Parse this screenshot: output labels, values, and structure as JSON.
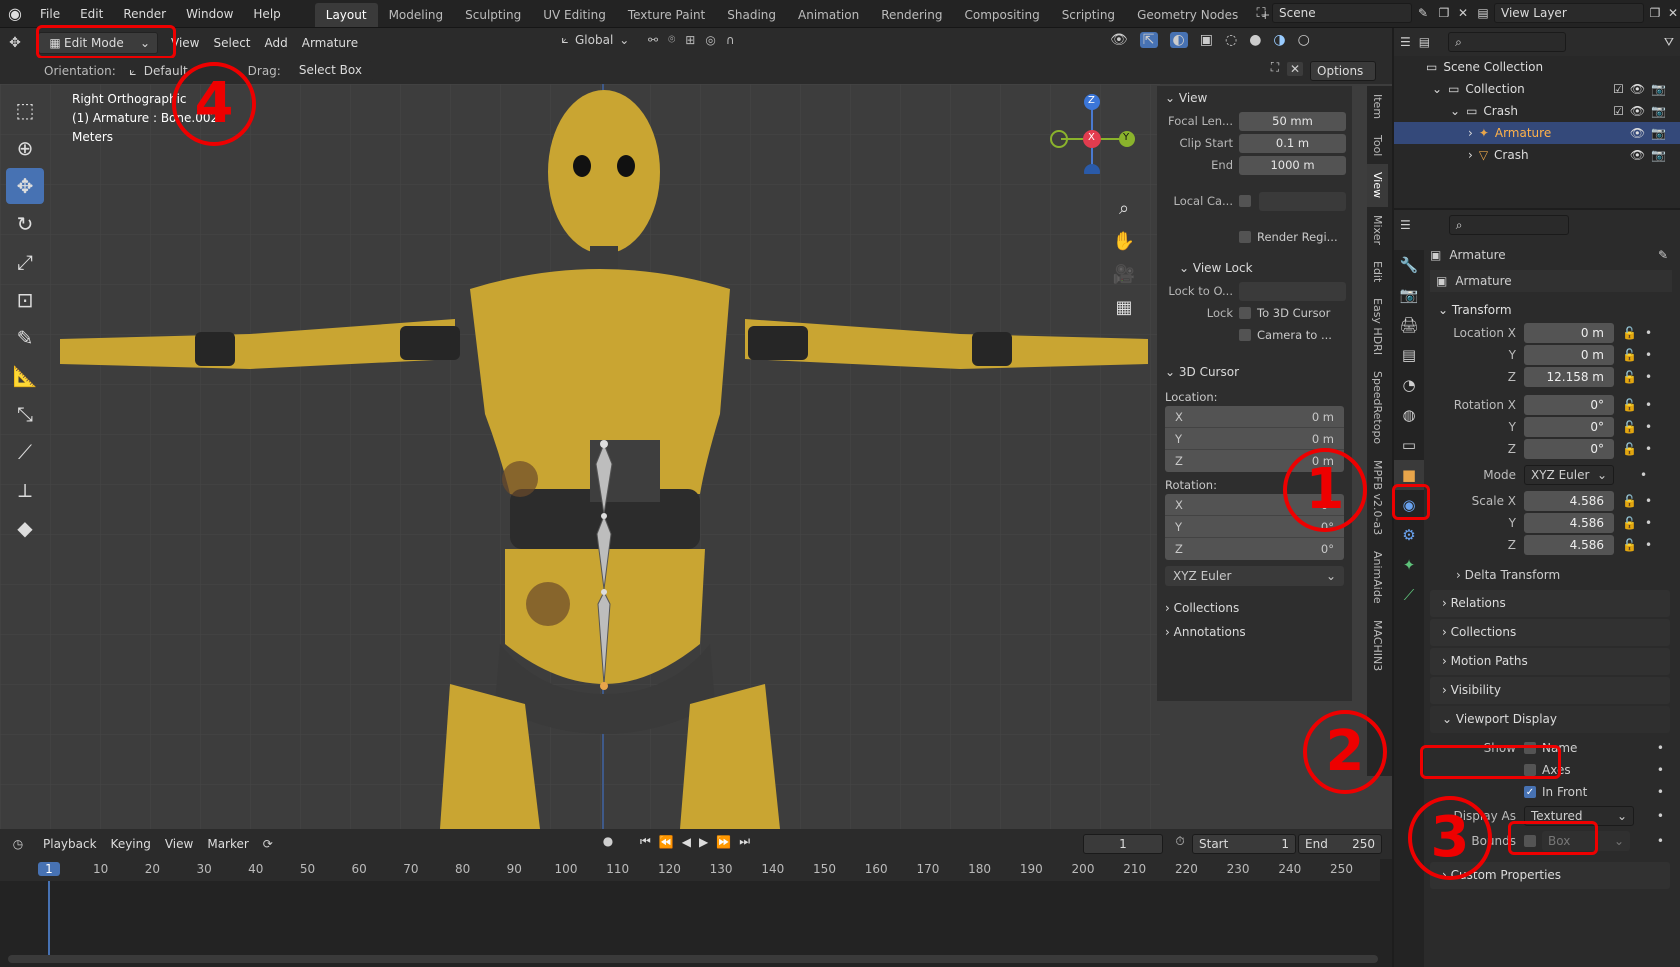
{
  "topbar": {
    "menus": [
      "File",
      "Edit",
      "Render",
      "Window",
      "Help"
    ],
    "workspaces": [
      "Layout",
      "Modeling",
      "Sculpting",
      "UV Editing",
      "Texture Paint",
      "Shading",
      "Animation",
      "Rendering",
      "Compositing",
      "Scripting",
      "Geometry Nodes"
    ],
    "active_workspace": "Layout",
    "add_tab": "+",
    "scene": "Scene",
    "view_layer": "View Layer"
  },
  "viewport_header": {
    "mode": "Edit Mode",
    "menus": [
      "View",
      "Select",
      "Add",
      "Armature"
    ],
    "transform_orientation": "Global",
    "orientation_label": "Orientation:",
    "orientation_value": "Default",
    "drag_label": "Drag:",
    "drag_value": "Select Box",
    "options": "Options"
  },
  "viewport": {
    "view_name": "Right Orthographic",
    "object_info": "(1) Armature : Bone.002",
    "units": "Meters",
    "gizmo": {
      "x": "X",
      "y": "Y",
      "z": "Z"
    }
  },
  "npanel": {
    "view": {
      "title": "View",
      "focal_label": "Focal Len...",
      "focal_value": "50 mm",
      "clip_start_label": "Clip Start",
      "clip_start_value": "0.1 m",
      "end_label": "End",
      "end_value": "1000 m",
      "local_camera_label": "Local Ca...",
      "render_region": "Render Regi..."
    },
    "view_lock": {
      "title": "View Lock",
      "lock_to_label": "Lock to O...",
      "lock_label": "Lock",
      "to_cursor": "To 3D Cursor",
      "camera_to": "Camera to ..."
    },
    "cursor": {
      "title": "3D Cursor",
      "location_label": "Location:",
      "loc": [
        {
          "axis": "X",
          "value": "0 m"
        },
        {
          "axis": "Y",
          "value": "0 m"
        },
        {
          "axis": "Z",
          "value": "0 m"
        }
      ],
      "rotation_label": "Rotation:",
      "rot": [
        {
          "axis": "X",
          "value": "0°"
        },
        {
          "axis": "Y",
          "value": "0°"
        },
        {
          "axis": "Z",
          "value": "0°"
        }
      ],
      "mode": "XYZ Euler"
    },
    "collections": "Collections",
    "annotations": "Annotations",
    "tabs": [
      "Item",
      "Tool",
      "View",
      "Mixer",
      "Edit",
      "Easy HDRI",
      "SpeedRetopo",
      "MPFB v2.0-a3",
      "AnimAide",
      "MACHIN3"
    ]
  },
  "outliner": {
    "root": "Scene Collection",
    "items": [
      {
        "label": "Collection",
        "indent": 1
      },
      {
        "label": "Crash",
        "indent": 2
      },
      {
        "label": "Armature",
        "indent": 3,
        "selected": true
      },
      {
        "label": "Crash",
        "indent": 3
      }
    ]
  },
  "properties": {
    "object_name": "Armature",
    "data_name": "Armature",
    "transform_title": "Transform",
    "location": [
      {
        "label": "Location X",
        "value": "0 m"
      },
      {
        "label": "Y",
        "value": "0 m"
      },
      {
        "label": "Z",
        "value": "12.158 m"
      }
    ],
    "rotation": [
      {
        "label": "Rotation X",
        "value": "0°"
      },
      {
        "label": "Y",
        "value": "0°"
      },
      {
        "label": "Z",
        "value": "0°"
      }
    ],
    "mode_label": "Mode",
    "mode_value": "XYZ Euler",
    "scale": [
      {
        "label": "Scale X",
        "value": "4.586"
      },
      {
        "label": "Y",
        "value": "4.586"
      },
      {
        "label": "Z",
        "value": "4.586"
      }
    ],
    "delta_transform": "Delta Transform",
    "sections": [
      "Relations",
      "Collections",
      "Motion Paths",
      "Visibility"
    ],
    "viewport_display": {
      "title": "Viewport Display",
      "show_label": "Show",
      "name": "Name",
      "axes": "Axes",
      "in_front": "In Front",
      "in_front_checked": true,
      "display_as_label": "Display As",
      "display_as_value": "Textured",
      "bounds_label": "Bounds",
      "bounds_value": "Box"
    },
    "custom_properties": "Custom Properties"
  },
  "timeline": {
    "menus": [
      "Playback",
      "Keying",
      "View",
      "Marker"
    ],
    "current_frame": "1",
    "start_label": "Start",
    "start": "1",
    "end_label": "End",
    "end": "250",
    "ticks": [
      "1",
      "10",
      "20",
      "30",
      "40",
      "50",
      "60",
      "70",
      "80",
      "90",
      "100",
      "110",
      "120",
      "130",
      "140",
      "150",
      "160",
      "170",
      "180",
      "190",
      "200",
      "210",
      "220",
      "230",
      "240",
      "250"
    ]
  },
  "annotations": {
    "one": "1",
    "two": "2",
    "three": "3",
    "four": "4"
  },
  "colors": {
    "accent": "#4772b3",
    "annotation": "#ee0000",
    "dummy": "#d4b23a"
  }
}
